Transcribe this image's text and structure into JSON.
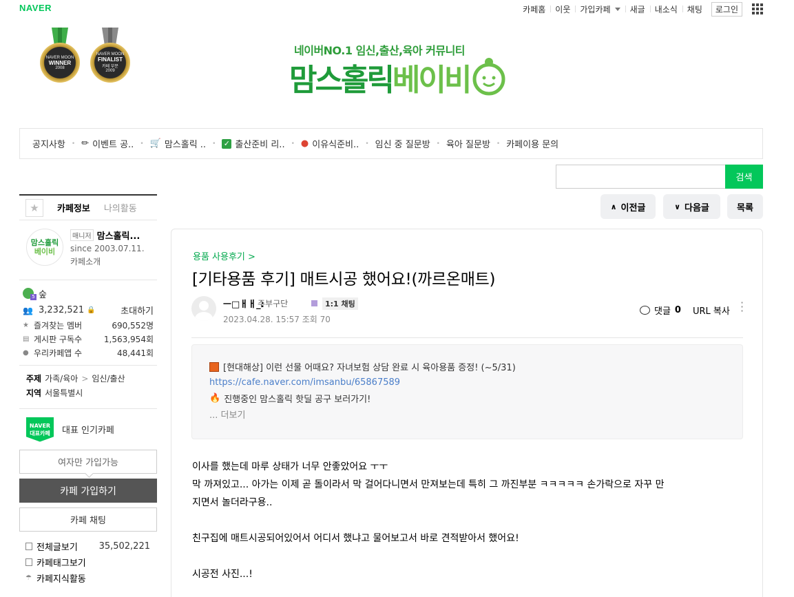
{
  "topbar": {
    "logo": "NAVER",
    "links": [
      "카페홈",
      "이웃",
      "가입카페",
      "새글",
      "내소식",
      "채팅"
    ],
    "login": "로그인"
  },
  "header": {
    "medals": [
      {
        "top": "NAVER MOON",
        "label": "WINNER",
        "year": "2008"
      },
      {
        "top": "NAVER MOON",
        "label": "FINALIST",
        "sub": "카페 부문",
        "year": "2009"
      }
    ],
    "tagline": "네이버NO.1 임신,출산,육아 커뮤니티",
    "logo_a": "맘스홀릭",
    "logo_b": "베이비"
  },
  "menu": [
    {
      "label": "공지사항",
      "icon": ""
    },
    {
      "label": "이벤트 공..",
      "icon": "party-popper"
    },
    {
      "label": "맘스홀릭 ..",
      "icon": "shopping-cart"
    },
    {
      "label": "출산준비 리..",
      "icon": "check-box"
    },
    {
      "label": "이유식준비..",
      "icon": "strawberry"
    },
    {
      "label": "임신 중 질문방",
      "icon": ""
    },
    {
      "label": "육아 질문방",
      "icon": ""
    },
    {
      "label": "카페이용 문의",
      "icon": ""
    }
  ],
  "search": {
    "placeholder": "",
    "button": "검색"
  },
  "sidebar": {
    "tab_info": "카페정보",
    "tab_activity": "나의활동",
    "thumb_line1": "맘스홀릭",
    "thumb_line2": "베이비",
    "manager_badge": "매니저",
    "cafe_name": "맘스홀릭...",
    "since": "since 2003.07.11.",
    "intro": "카페소개",
    "level": "숲",
    "members": "3,232,521",
    "invite": "초대하기",
    "stats": [
      {
        "label": "즐겨찾는 멤버",
        "value": "690,552명"
      },
      {
        "label": "게시판 구독수",
        "value": "1,563,954회"
      },
      {
        "label": "우리카페앱 수",
        "value": "48,441회"
      }
    ],
    "topic_label": "주제",
    "topic_a": "가족/육아",
    "topic_b": "임신/출산",
    "region_label": "지역",
    "region": "서울특별시",
    "rep_badge_1": "NAVER",
    "rep_badge_2": "대표카페",
    "rep_text": "대표 인기카페",
    "women_only": "여자만 가입가능",
    "join": "카페 가입하기",
    "chat": "카페 채팅",
    "all_posts": "전체글보기",
    "all_posts_count": "35,502,221",
    "tags": "카페태그보기",
    "knowledge": "카페지식활동"
  },
  "nav": {
    "prev": "이전글",
    "next": "다음글",
    "list": "목록"
  },
  "article": {
    "board": "용품 사용후기 >",
    "title": "[기타용품 후기] 매트시공 했어요!(까르온매트)",
    "nickname": "ㅡ□ㅐㅐ_:",
    "grade": "주부구단",
    "chat_badge": "1:1 채팅",
    "date": "2023.04.28. 15:57",
    "views": "조회 70",
    "comment_label": "댓글",
    "comment_count": "0",
    "url_copy": "URL 복사",
    "notice_line1": "[현대해상] 이런 선물 어때요? 자녀보험 상담 완료 시 육아용품 증정! (~5/31)",
    "notice_link": "https://cafe.naver.com/imsanbu/65867589",
    "notice_line3": "진행중인 맘스홀릭 핫딜 공구 보러가기!",
    "notice_more": "... 더보기",
    "body": [
      "이사를 했는데 마루 상태가 너무 안좋았어요 ㅜㅜ",
      "막 까져있고... 아가는 이제 곧 돌이라서 막 걸어다니면서 만져보는데 특히 그 까진부분 ㅋㅋㅋㅋㅋ 손가락으로 자꾸 만",
      "지면서 놀더라구용..",
      "친구집에 매트시공되어있어서 어디서 했냐고 물어보고서 바로 견적받아서 했어요!",
      "시공전 사진...!"
    ]
  }
}
